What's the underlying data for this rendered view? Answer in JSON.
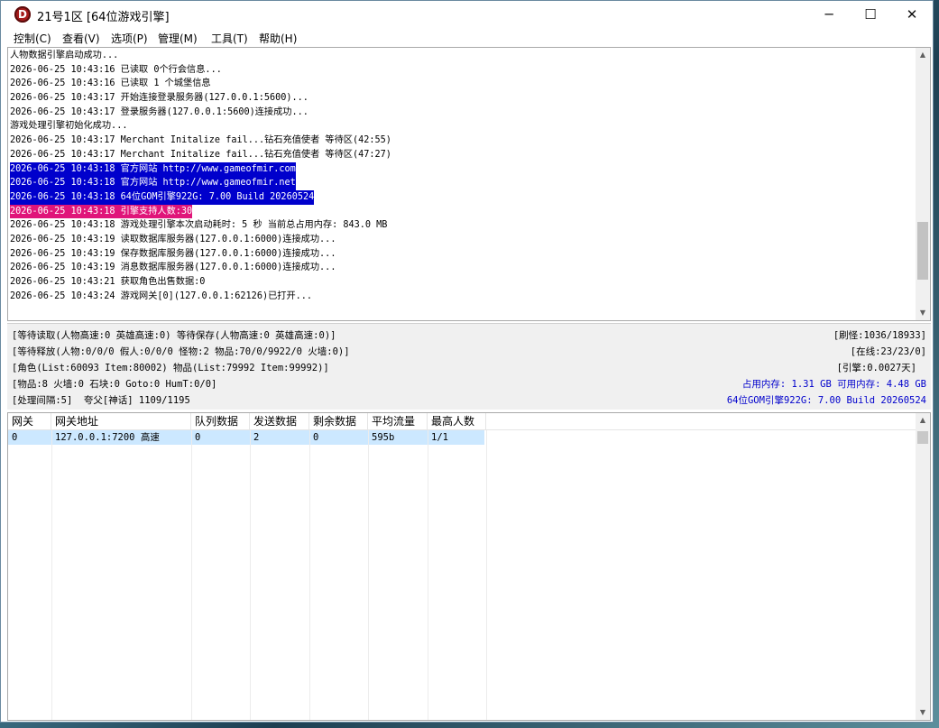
{
  "window": {
    "app_icon_letter": "D",
    "title": "21号1区 [64位游戏引擎]",
    "controls": {
      "minimize": "─",
      "maximize": "☐",
      "close": "✕"
    }
  },
  "menu": [
    "控制(C)",
    "查看(V)",
    "选项(P)",
    "管理(M)",
    "工具(T)",
    "帮助(H)"
  ],
  "log": {
    "lines": [
      {
        "text": "人物数据引擎启动成功...",
        "style": ""
      },
      {
        "text": "2026-06-25 10:43:16 已读取 0个行会信息...",
        "style": ""
      },
      {
        "text": "2026-06-25 10:43:16 已读取 1 个城堡信息",
        "style": ""
      },
      {
        "text": "2026-06-25 10:43:17 开始连接登录服务器(127.0.0.1:5600)...",
        "style": ""
      },
      {
        "text": "2026-06-25 10:43:17 登录服务器(127.0.0.1:5600)连接成功...",
        "style": ""
      },
      {
        "text": "游戏处理引擎初始化成功...",
        "style": ""
      },
      {
        "text": "2026-06-25 10:43:17 Merchant Initalize fail...钻石充值使者 等待区(42:55)",
        "style": ""
      },
      {
        "text": "2026-06-25 10:43:17 Merchant Initalize fail...钻石充值使者 等待区(47:27)",
        "style": ""
      },
      {
        "text": "2026-06-25 10:43:18 官方网站 http://www.gameofmir.com",
        "style": "hl-blue"
      },
      {
        "text": "2026-06-25 10:43:18 官方网站 http://www.gameofmir.net",
        "style": "hl-blue"
      },
      {
        "text": "2026-06-25 10:43:18 64位GOM引擎922G: 7.00 Build 20260524",
        "style": "hl-blue"
      },
      {
        "text": "2026-06-25 10:43:18 引擎支持人数:30",
        "style": "hl-pink"
      },
      {
        "text": "2026-06-25 10:43:18 游戏处理引擎本次启动耗时: 5 秒 当前总占用内存: 843.0 MB",
        "style": ""
      },
      {
        "text": "2026-06-25 10:43:19 读取数据库服务器(127.0.0.1:6000)连接成功...",
        "style": ""
      },
      {
        "text": "2026-06-25 10:43:19 保存数据库服务器(127.0.0.1:6000)连接成功...",
        "style": ""
      },
      {
        "text": "2026-06-25 10:43:19 消息数据库服务器(127.0.0.1:6000)连接成功...",
        "style": ""
      },
      {
        "text": "2026-06-25 10:43:21 获取角色出售数据:0",
        "style": ""
      },
      {
        "text": "2026-06-25 10:43:24 游戏网关[0](127.0.0.1:62126)已打开...",
        "style": ""
      }
    ],
    "scrollbar": {
      "up": "▲",
      "down": "▼",
      "thumb_position": 0.85
    }
  },
  "status": {
    "left": [
      "[等待读取(人物高速:0 英雄高速:0) 等待保存(人物高速:0 英雄高速:0)]",
      "[等待释放(人物:0/0/0 假人:0/0/0 怪物:2 物品:70/0/9922/0 火墙:0)]",
      "[角色(List:60093 Item:80002) 物品(List:79992 Item:99992)]",
      "[物品:8 火墙:0 石块:0 Goto:0 HumT:0/0]",
      "[处理间隔:5]  夸父[神话] 1109/1195"
    ],
    "right": [
      {
        "text": "[刷怪:1036/18933]",
        "color": "#000000"
      },
      {
        "text": "[在线:23/23/0]",
        "color": "#000000"
      },
      {
        "text": "[引擎:0.0027天]",
        "color": "#000000"
      },
      {
        "text": "占用内存: 1.31 GB 可用内存: 4.48 GB",
        "color": "#0000cc"
      },
      {
        "text": "64位GOM引擎922G: 7.00 Build 20260524",
        "color": "#0000cc"
      }
    ]
  },
  "gateway_table": {
    "columns": [
      "网关",
      "网关地址",
      "队列数据",
      "发送数据",
      "剩余数据",
      "平均流量",
      "最高人数"
    ],
    "rows": [
      [
        "0",
        "127.0.0.1:7200 高速",
        "0",
        "2",
        "0",
        "595b",
        "1/1"
      ]
    ],
    "scrollbar": {
      "up": "▲",
      "down": "▼"
    }
  }
}
